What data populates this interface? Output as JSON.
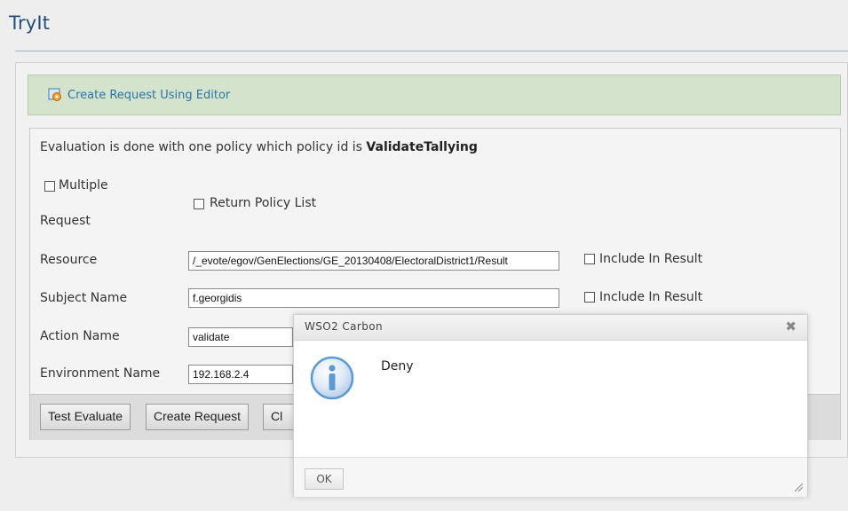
{
  "page": {
    "title": "TryIt"
  },
  "editor_bar": {
    "link_label": "Create Request Using Editor",
    "icon": "editor-gear-icon"
  },
  "form": {
    "evaluation_prefix": "Evaluation is done with one policy which policy id is ",
    "policy_id": "ValidateTallying",
    "multiple_request": {
      "label_line1": "Multiple",
      "label_line2": "Request",
      "checked": false
    },
    "return_policy_list": {
      "label": "Return Policy List",
      "checked": false
    },
    "resource": {
      "label": "Resource",
      "value": "/_evote/egov/GenElections/GE_20130408/ElectoralDistrict1/Result",
      "include_label": "Include In Result",
      "include_checked": false
    },
    "subject": {
      "label": "Subject Name",
      "value": "f.georgidis",
      "include_label": "Include In Result",
      "include_checked": false
    },
    "action": {
      "label": "Action Name",
      "value": "validate"
    },
    "environment": {
      "label": "Environment Name",
      "value": "192.168.2.4"
    }
  },
  "buttons": {
    "test_evaluate": "Test Evaluate",
    "create_request": "Create Request",
    "clear": "Cl"
  },
  "dialog": {
    "title": "WSO2 Carbon",
    "close_glyph": "✖",
    "message": "Deny",
    "ok_label": "OK",
    "icon": "info-icon"
  },
  "colors": {
    "title": "#1f4e79",
    "editor_bar_bg": "#d3e3cc",
    "link": "#2c72a8",
    "info_icon": "#5a9bd5"
  }
}
